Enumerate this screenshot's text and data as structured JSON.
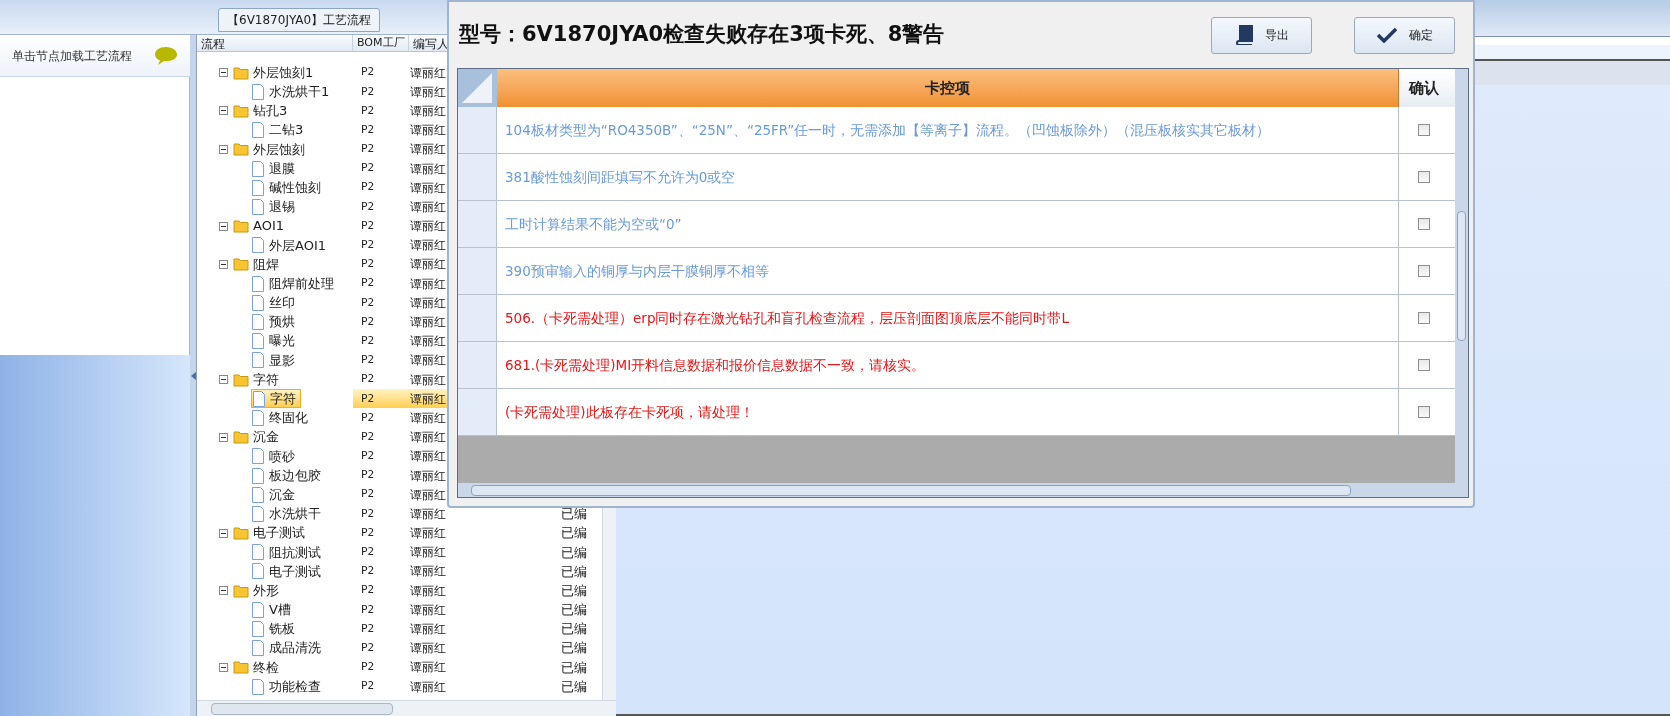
{
  "left_panel": {
    "hint": "单击节点加载工艺流程"
  },
  "process_panel": {
    "title": "【6V1870JYA0】工艺流程",
    "columns": [
      "流程",
      "BOM工厂",
      "编写人"
    ],
    "tree": [
      {
        "name": "外层蚀刻1",
        "bom": "P2",
        "writer": "谭丽红",
        "expanded": true,
        "selected": false,
        "children": [
          {
            "name": "水洗烘干1",
            "bom": "P2",
            "writer": "谭丽红",
            "selected": false
          }
        ]
      },
      {
        "name": "钻孔3",
        "bom": "P2",
        "writer": "谭丽红",
        "expanded": true,
        "selected": false,
        "children": [
          {
            "name": "二钻3",
            "bom": "P2",
            "writer": "谭丽红",
            "selected": false
          }
        ]
      },
      {
        "name": "外层蚀刻",
        "bom": "P2",
        "writer": "谭丽红",
        "expanded": true,
        "selected": false,
        "children": [
          {
            "name": "退膜",
            "bom": "P2",
            "writer": "谭丽红",
            "selected": false
          },
          {
            "name": "碱性蚀刻",
            "bom": "P2",
            "writer": "谭丽红",
            "selected": false
          },
          {
            "name": "退锡",
            "bom": "P2",
            "writer": "谭丽红",
            "selected": false
          }
        ]
      },
      {
        "name": "AOI1",
        "bom": "P2",
        "writer": "谭丽红",
        "expanded": true,
        "selected": false,
        "children": [
          {
            "name": "外层AOI1",
            "bom": "P2",
            "writer": "谭丽红",
            "selected": false
          }
        ]
      },
      {
        "name": "阻焊",
        "bom": "P2",
        "writer": "谭丽红",
        "expanded": true,
        "selected": false,
        "children": [
          {
            "name": "阻焊前处理",
            "bom": "P2",
            "writer": "谭丽红",
            "selected": false
          },
          {
            "name": "丝印",
            "bom": "P2",
            "writer": "谭丽红",
            "selected": false
          },
          {
            "name": "预烘",
            "bom": "P2",
            "writer": "谭丽红",
            "selected": false
          },
          {
            "name": "曝光",
            "bom": "P2",
            "writer": "谭丽红",
            "selected": false
          },
          {
            "name": "显影",
            "bom": "P2",
            "writer": "谭丽红",
            "selected": false
          }
        ]
      },
      {
        "name": "字符",
        "bom": "P2",
        "writer": "谭丽红",
        "expanded": true,
        "selected": false,
        "children": [
          {
            "name": "字符",
            "bom": "P2",
            "writer": "谭丽红",
            "selected": true
          },
          {
            "name": "终固化",
            "bom": "P2",
            "writer": "谭丽红",
            "selected": false
          }
        ]
      },
      {
        "name": "沉金",
        "bom": "P2",
        "writer": "谭丽红",
        "expanded": true,
        "selected": false,
        "children": [
          {
            "name": "喷砂",
            "bom": "P2",
            "writer": "谭丽红",
            "selected": false
          },
          {
            "name": "板边包胶",
            "bom": "P2",
            "writer": "谭丽红",
            "selected": false
          },
          {
            "name": "沉金",
            "bom": "P2",
            "writer": "谭丽红",
            "selected": false
          },
          {
            "name": "水洗烘干",
            "bom": "P2",
            "writer": "谭丽红",
            "status": "已编",
            "selected": false
          }
        ]
      },
      {
        "name": "电子测试",
        "bom": "P2",
        "writer": "谭丽红",
        "status": "已编",
        "expanded": true,
        "selected": false,
        "children": [
          {
            "name": "阻抗测试",
            "bom": "P2",
            "writer": "谭丽红",
            "status": "已编",
            "selected": false
          },
          {
            "name": "电子测试",
            "bom": "P2",
            "writer": "谭丽红",
            "status": "已编",
            "selected": false
          }
        ]
      },
      {
        "name": "外形",
        "bom": "P2",
        "writer": "谭丽红",
        "status": "已编",
        "expanded": true,
        "selected": false,
        "children": [
          {
            "name": "V槽",
            "bom": "P2",
            "writer": "谭丽红",
            "status": "已编",
            "selected": false
          },
          {
            "name": "铣板",
            "bom": "P2",
            "writer": "谭丽红",
            "status": "已编",
            "selected": false
          },
          {
            "name": "成品清洗",
            "bom": "P2",
            "writer": "谭丽红",
            "status": "已编",
            "selected": false
          }
        ]
      },
      {
        "name": "终检",
        "bom": "P2",
        "writer": "谭丽红",
        "status": "已编",
        "expanded": true,
        "selected": false,
        "children": [
          {
            "name": "功能检查",
            "bom": "P2",
            "writer": "谭丽红",
            "status": "已编",
            "selected": false
          }
        ]
      }
    ]
  },
  "dialog": {
    "title": "型号：6V1870JYA0检查失败存在3项卡死、8警告",
    "buttons": [
      {
        "label": "导出",
        "kind": "export"
      },
      {
        "label": "确定",
        "kind": "confirm"
      }
    ],
    "grid": {
      "columns": [
        "卡控项",
        "确认"
      ],
      "rows": [
        {
          "text": "104板材类型为“RO4350B”、“25N”、“25FR”任一时，无需添加【等离子】流程。（凹蚀板除外）（混压板核实其它板材）",
          "color": "#6a9ad6",
          "checked": false
        },
        {
          "text": "381酸性蚀刻间距填写不允许为0或空",
          "color": "#6a9ad6",
          "checked": false
        },
        {
          "text": "工时计算结果不能为空或“0”",
          "color": "#6a9ad6",
          "checked": false
        },
        {
          "text": "390预审输入的铜厚与内层干膜铜厚不相等",
          "color": "#6a9ad6",
          "checked": false
        },
        {
          "text": "506.（卡死需处理）erp同时存在激光钻孔和盲孔检查流程，层压剖面图顶底层不能同时带L",
          "color": "#e01818",
          "checked": false
        },
        {
          "text": "681.(卡死需处理)MI开料信息数据和报价信息数据不一致，请核实。",
          "color": "#e01818",
          "checked": false
        },
        {
          "text": "(卡死需处理)此板存在卡死项，请处理！",
          "color": "#e01818",
          "checked": false
        }
      ]
    }
  }
}
